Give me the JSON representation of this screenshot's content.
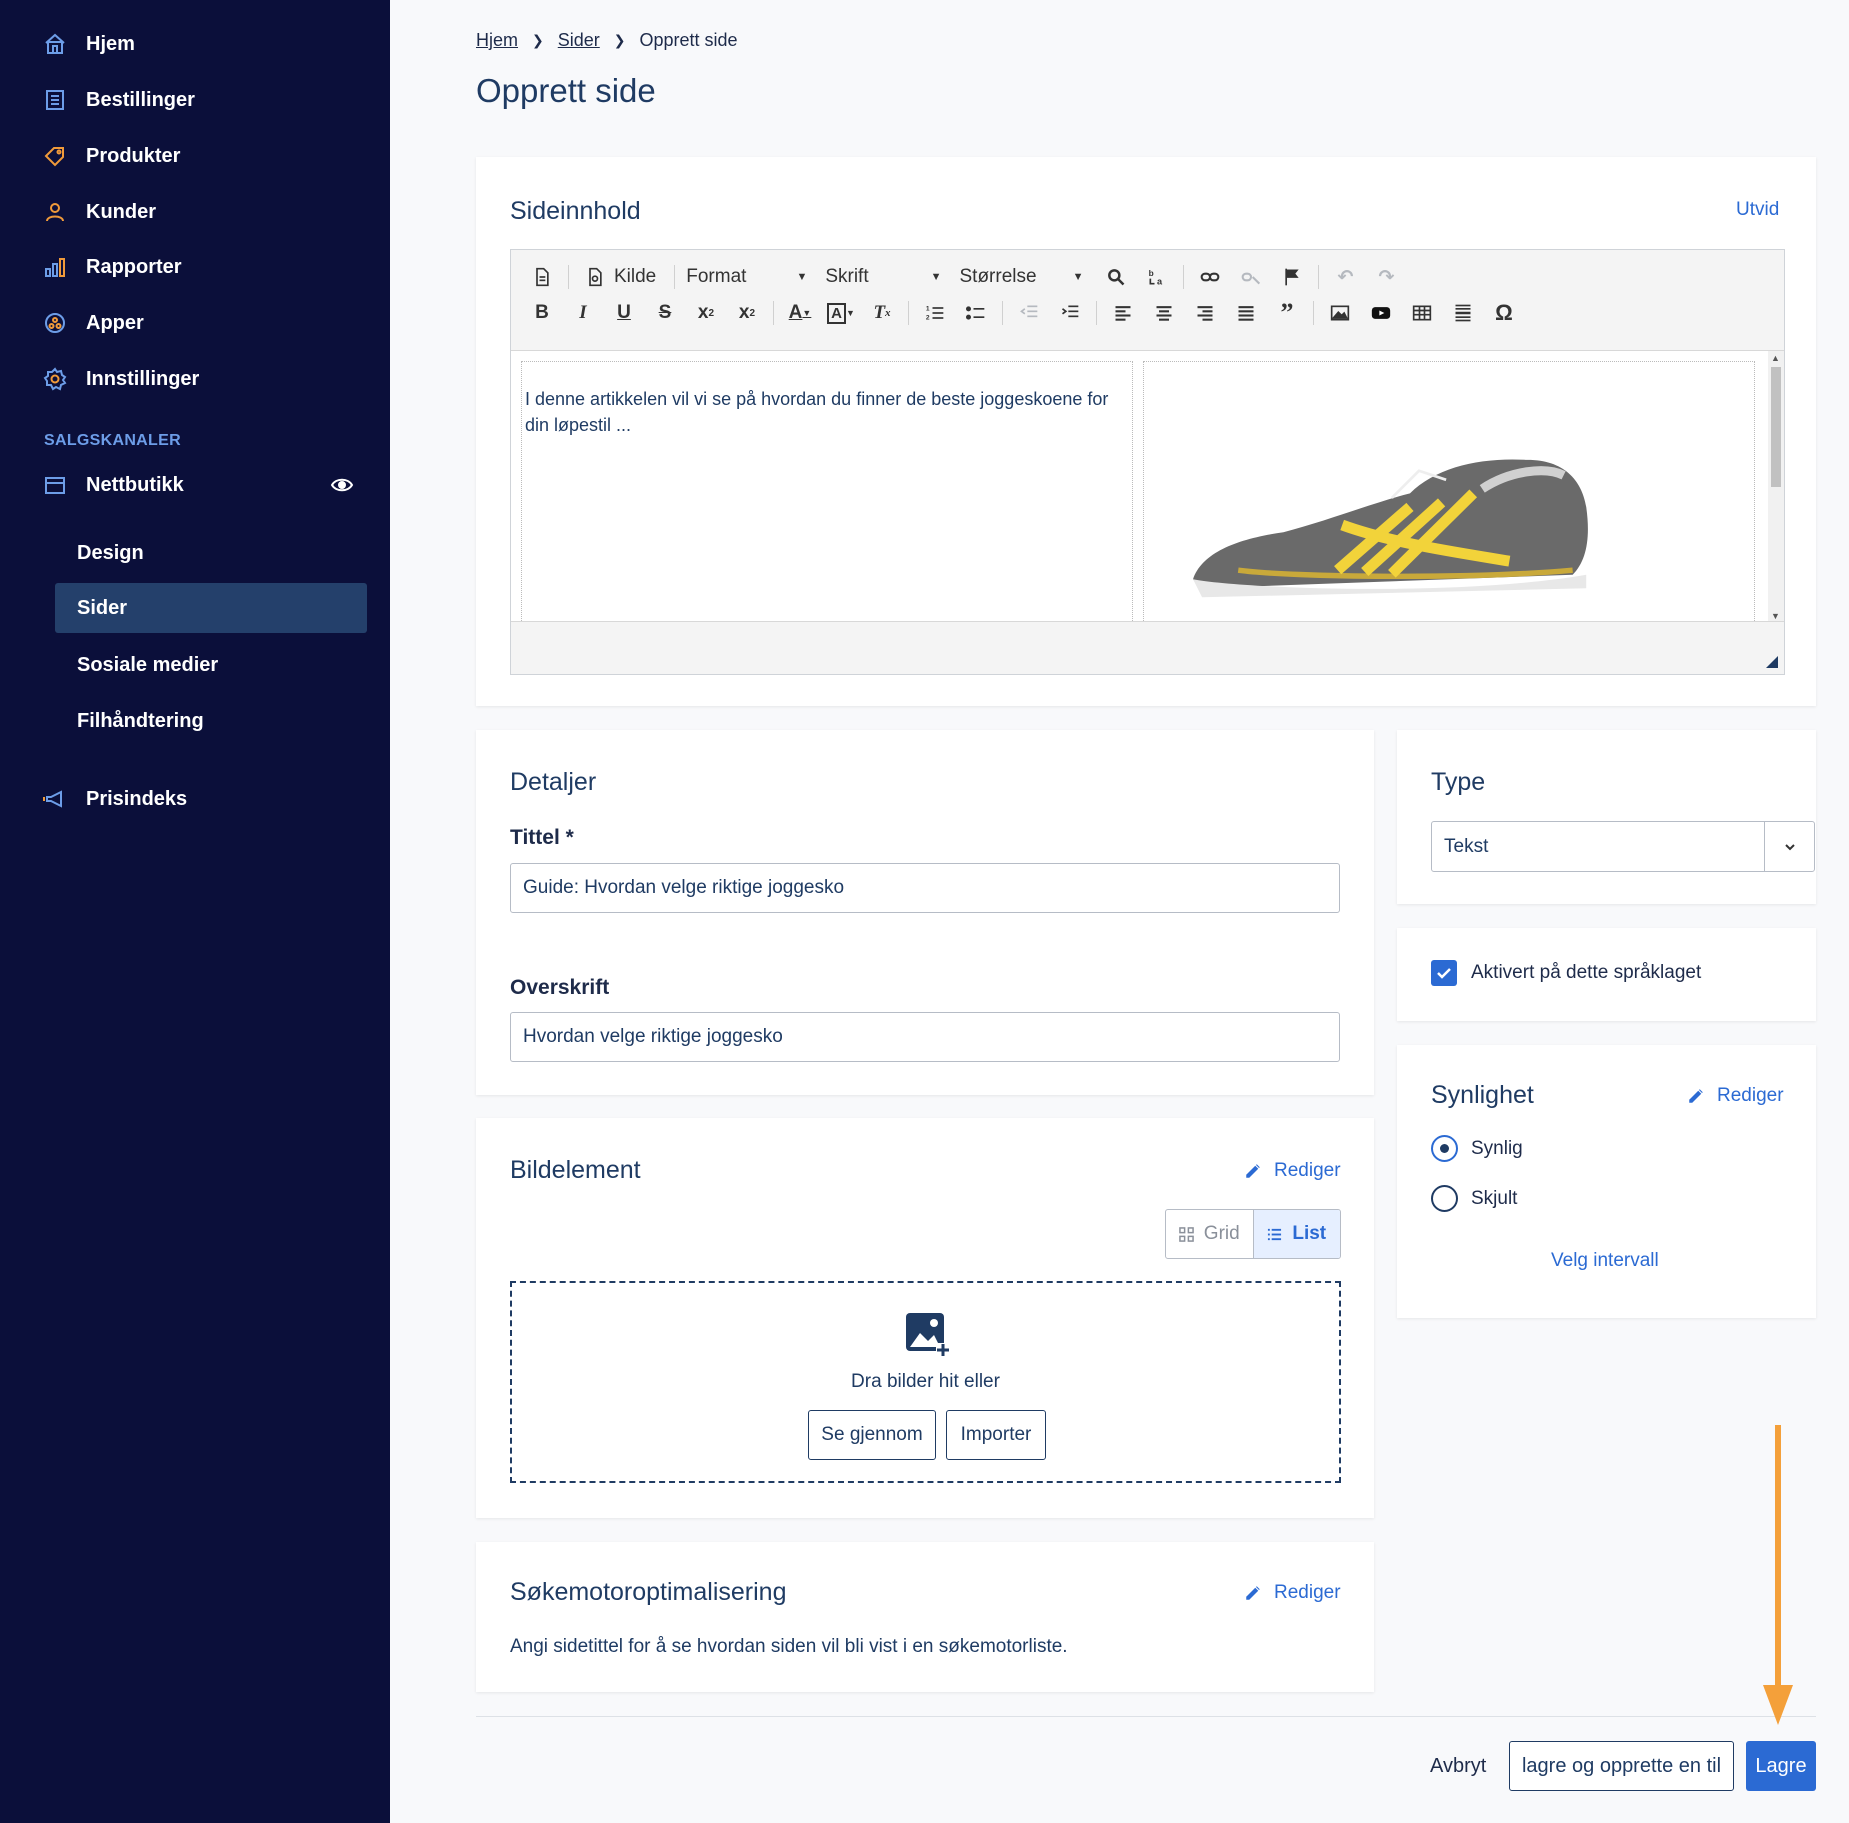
{
  "sidebar": {
    "items": [
      {
        "label": "Hjem",
        "icon": "home-icon"
      },
      {
        "label": "Bestillinger",
        "icon": "orders-icon"
      },
      {
        "label": "Produkter",
        "icon": "tag-icon"
      },
      {
        "label": "Kunder",
        "icon": "user-icon"
      },
      {
        "label": "Rapporter",
        "icon": "bar-chart-icon"
      },
      {
        "label": "Apper",
        "icon": "apps-icon"
      },
      {
        "label": "Innstillinger",
        "icon": "gear-icon"
      }
    ],
    "section_label": "SALGSKANALER",
    "channel": {
      "label": "Nettbutikk",
      "icon": "store-icon"
    },
    "sub_items": [
      {
        "label": "Design"
      },
      {
        "label": "Sider",
        "active": true
      },
      {
        "label": "Sosiale medier"
      },
      {
        "label": "Filhåndtering"
      }
    ],
    "bottom_item": {
      "label": "Prisindeks",
      "icon": "megaphone-icon"
    }
  },
  "breadcrumb": [
    "Hjem",
    "Sider",
    "Opprett side"
  ],
  "page_title": "Opprett side",
  "content_card": {
    "title": "Sideinnhold",
    "expand_link": "Utvid",
    "toolbar": {
      "source_label": "Kilde",
      "format_label": "Format",
      "font_label": "Skrift",
      "size_label": "Størrelse"
    },
    "body_text": "I denne artikkelen vil vi se på hvordan du finner de beste joggeskoene for din løpestil ..."
  },
  "details_card": {
    "title": "Detaljer",
    "title_label": "Tittel *",
    "title_value": "Guide: Hvordan velge riktige joggesko",
    "heading_label": "Overskrift",
    "heading_value": "Hvordan velge riktige joggesko"
  },
  "image_card": {
    "title": "Bildelement",
    "edit_link": "Rediger",
    "view_grid": "Grid",
    "view_list": "List",
    "drop_text": "Dra bilder hit eller",
    "browse_button": "Se gjennom",
    "import_button": "Importer"
  },
  "seo_card": {
    "title": "Søkemotoroptimalisering",
    "edit_link": "Rediger",
    "description": "Angi sidetittel for å se hvordan siden vil bli vist i en søkemotorliste."
  },
  "type_card": {
    "title": "Type",
    "selected": "Tekst"
  },
  "language_card": {
    "checkbox_label": "Aktivert på dette språklaget",
    "checked": true
  },
  "visibility_card": {
    "title": "Synlighet",
    "edit_link": "Rediger",
    "options": [
      {
        "label": "Synlig",
        "checked": true
      },
      {
        "label": "Skjult",
        "checked": false
      }
    ],
    "interval_link": "Velg intervall"
  },
  "footer": {
    "cancel": "Avbryt",
    "save_and_new": "lagre og opprette en til",
    "save": "Lagre"
  },
  "colors": {
    "sidebar_bg": "#0b0f3a",
    "accent": "#2b6ad3",
    "annotation_arrow": "#f4a03a"
  }
}
